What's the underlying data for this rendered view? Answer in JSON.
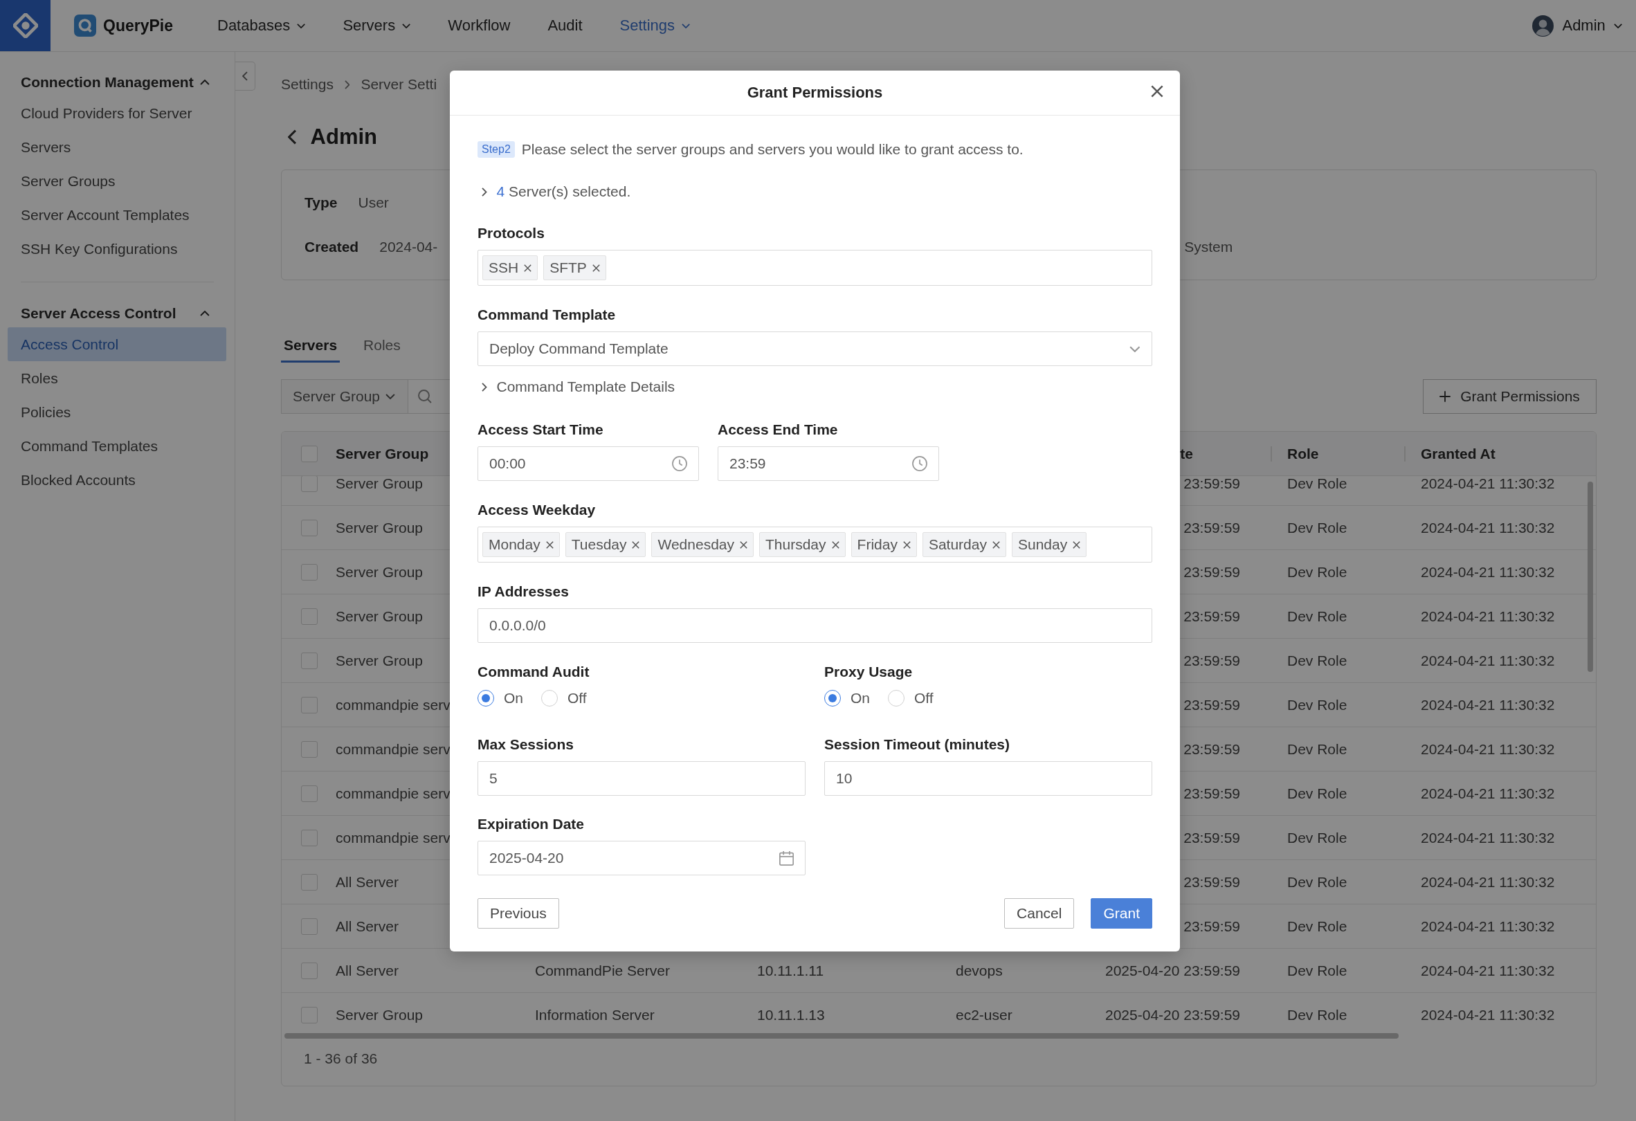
{
  "app": {
    "name": "QueryPie"
  },
  "nav": [
    {
      "label": "Databases",
      "dropdown": true,
      "selected": false
    },
    {
      "label": "Servers",
      "dropdown": true,
      "selected": false
    },
    {
      "label": "Workflow",
      "dropdown": false,
      "selected": false
    },
    {
      "label": "Audit",
      "dropdown": false,
      "selected": false
    },
    {
      "label": "Settings",
      "dropdown": true,
      "selected": true
    }
  ],
  "user": {
    "name": "Admin"
  },
  "sidebar": {
    "sections": [
      {
        "title": "Connection Management",
        "expanded": true,
        "items": [
          {
            "label": "Cloud Providers for Server",
            "selected": false
          },
          {
            "label": "Servers",
            "selected": false
          },
          {
            "label": "Server Groups",
            "selected": false
          },
          {
            "label": "Server Account Templates",
            "selected": false
          },
          {
            "label": "SSH Key Configurations",
            "selected": false
          }
        ]
      },
      {
        "title": "Server Access Control",
        "expanded": true,
        "items": [
          {
            "label": "Access Control",
            "selected": true
          },
          {
            "label": "Roles",
            "selected": false
          },
          {
            "label": "Policies",
            "selected": false
          },
          {
            "label": "Command Templates",
            "selected": false
          },
          {
            "label": "Blocked Accounts",
            "selected": false
          }
        ]
      }
    ]
  },
  "breadcrumb": [
    "Settings",
    "Server Setti"
  ],
  "page_title": "Admin",
  "details": [
    {
      "label": "Type",
      "value": "User"
    },
    {
      "label": "Created",
      "value": "2024-04-",
      "column_3": "System"
    }
  ],
  "tabs": [
    {
      "label": "Servers",
      "selected": true
    },
    {
      "label": "Roles",
      "selected": false
    }
  ],
  "filter": {
    "label": "Server Group"
  },
  "grant_button": {
    "label": "Grant Permissions"
  },
  "table": {
    "all_checked": false,
    "columns": [
      "Server Group",
      "te",
      "Role",
      "Granted At"
    ],
    "rows": [
      {
        "checked": false,
        "server_group": "Server Group",
        "column_5": "23:59:59",
        "role": "Dev Role",
        "granted_at": "2024-04-21 11:30:32"
      },
      {
        "checked": false,
        "server_group": "Server Group",
        "column_5": "23:59:59",
        "role": "Dev Role",
        "granted_at": "2024-04-21 11:30:32"
      },
      {
        "checked": false,
        "server_group": "Server Group",
        "column_5": "23:59:59",
        "role": "Dev Role",
        "granted_at": "2024-04-21 11:30:32"
      },
      {
        "checked": false,
        "server_group": "Server Group",
        "column_5": "23:59:59",
        "role": "Dev Role",
        "granted_at": "2024-04-21 11:30:32"
      },
      {
        "checked": false,
        "server_group": "Server Group",
        "column_5": "23:59:59",
        "role": "Dev Role",
        "granted_at": "2024-04-21 11:30:32"
      },
      {
        "checked": false,
        "server_group": "commandpie serv",
        "column_5": "23:59:59",
        "role": "Dev Role",
        "granted_at": "2024-04-21 11:30:32"
      },
      {
        "checked": false,
        "server_group": "commandpie serv",
        "column_5": "23:59:59",
        "role": "Dev Role",
        "granted_at": "2024-04-21 11:30:32"
      },
      {
        "checked": false,
        "server_group": "commandpie serv",
        "column_5": "23:59:59",
        "role": "Dev Role",
        "granted_at": "2024-04-21 11:30:32"
      },
      {
        "checked": false,
        "server_group": "commandpie serv",
        "column_5": "23:59:59",
        "role": "Dev Role",
        "granted_at": "2024-04-21 11:30:32"
      },
      {
        "checked": false,
        "server_group": "All Server",
        "column_5": "23:59:59",
        "role": "Dev Role",
        "granted_at": "2024-04-21 11:30:32"
      },
      {
        "checked": false,
        "server_group": "All Server",
        "column_5": "23:59:59",
        "role": "Dev Role",
        "granted_at": "2024-04-21 11:30:32"
      },
      {
        "checked": false,
        "server_group": "All Server",
        "column_2": "CommandPie Server",
        "column_3": "10.11.1.11",
        "column_4": "devops",
        "column_5": "2025-04-20 23:59:59",
        "role": "Dev Role",
        "granted_at": "2024-04-21 11:30:32"
      },
      {
        "checked": false,
        "server_group": "Server Group",
        "column_2": "Information Server",
        "column_3": "10.11.1.13",
        "column_4": "ec2-user",
        "column_5": "2025-04-20 23:59:59",
        "role": "Dev Role",
        "granted_at": "2024-04-21 11:30:32"
      }
    ],
    "pagination": "1 - 36 of 36"
  },
  "modal": {
    "title": "Grant Permissions",
    "step_badge": "Step2",
    "instruction": "Please select the server groups and servers you would like to grant access to.",
    "selection": {
      "count": "4",
      "text": "Server(s) selected.",
      "expanded": false
    },
    "protocols": {
      "label": "Protocols",
      "tags": [
        "SSH",
        "SFTP"
      ]
    },
    "command_template": {
      "label": "Command Template",
      "value": "Deploy Command Template"
    },
    "template_details": {
      "label": "Command Template Details",
      "expanded": false
    },
    "access_start": {
      "label": "Access Start Time",
      "value": "00:00"
    },
    "access_end": {
      "label": "Access End Time",
      "value": "23:59"
    },
    "weekdays": {
      "label": "Access Weekday",
      "tags": [
        "Monday",
        "Tuesday",
        "Wednesday",
        "Thursday",
        "Friday",
        "Saturday",
        "Sunday"
      ]
    },
    "ip_addresses": {
      "label": "IP Addresses",
      "value": "0.0.0.0/0"
    },
    "command_audit": {
      "label": "Command Audit",
      "options": [
        {
          "label": "On",
          "selected": true
        },
        {
          "label": "Off",
          "selected": false
        }
      ]
    },
    "proxy_usage": {
      "label": "Proxy Usage",
      "options": [
        {
          "label": "On",
          "selected": true
        },
        {
          "label": "Off",
          "selected": false
        }
      ]
    },
    "max_sessions": {
      "label": "Max Sessions",
      "value": "5"
    },
    "session_timeout": {
      "label": "Session Timeout (minutes)",
      "value": "10"
    },
    "expiration": {
      "label": "Expiration Date",
      "value": "2025-04-20"
    },
    "buttons": [
      {
        "label": "Previous",
        "kind": "secondary"
      },
      {
        "label": "Cancel",
        "kind": "secondary"
      },
      {
        "label": "Grant",
        "kind": "primary"
      }
    ]
  }
}
